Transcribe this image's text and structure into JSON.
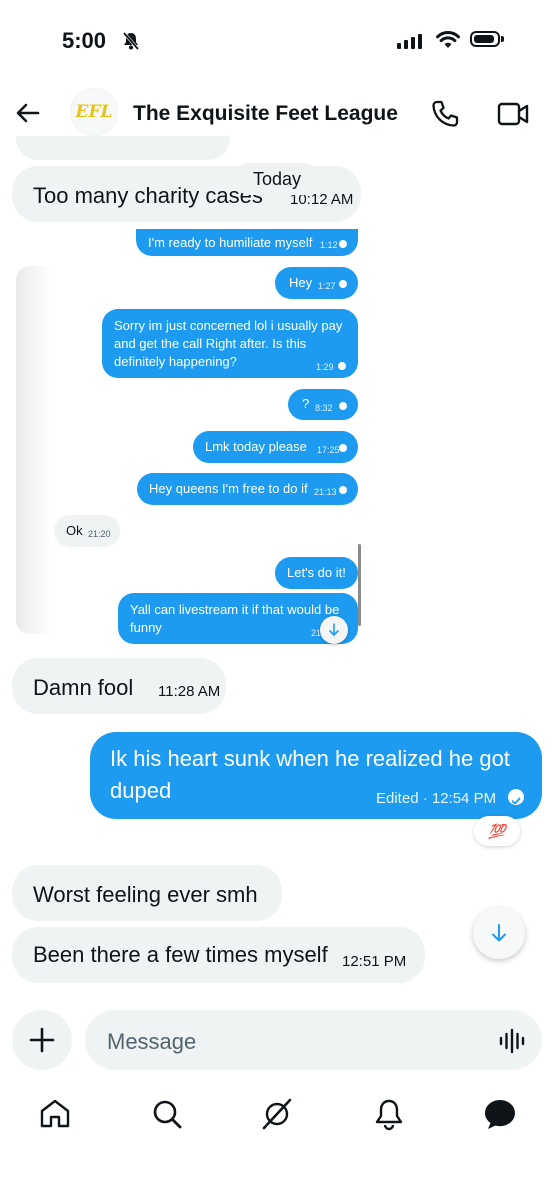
{
  "status_bar": {
    "time": "5:00",
    "silent_icon": "bell-slash-icon",
    "signal_icon": "cellular-signal-icon",
    "wifi_icon": "wifi-icon",
    "battery_icon": "battery-icon"
  },
  "header": {
    "title": "The Exquisite Feet League",
    "avatar_text": "EFL",
    "back_icon": "arrow-left-icon",
    "call_icon": "phone-icon",
    "video_icon": "video-camera-icon"
  },
  "date_divider": "Today",
  "messages": [
    {
      "text": "Too many charity cases",
      "time": "10:12 AM",
      "direction": "in"
    },
    {
      "text": "Damn fool",
      "time": "11:28 AM",
      "direction": "in"
    },
    {
      "text_line1": "Ik his heart sunk when he realized he got",
      "text_line2": "duped",
      "meta": "Edited · 12:54 PM",
      "direction": "out",
      "reaction": "💯"
    },
    {
      "text": "Worst feeling ever smh",
      "direction": "in"
    },
    {
      "text": "Been there a few times myself",
      "time": "12:51 PM",
      "direction": "in"
    }
  ],
  "embedded_chat": [
    {
      "text": "I'm ready to humiliate myself",
      "time": "1:12",
      "direction": "out"
    },
    {
      "text": "Hey",
      "time": "1:27",
      "direction": "out"
    },
    {
      "text_line1": "Sorry im just concerned lol i usually pay",
      "text_line2": "and get the call Right after. Is this",
      "text_line3": "definitely happening?",
      "time": "1:29",
      "direction": "out"
    },
    {
      "text": "?",
      "time": "8:32",
      "direction": "out"
    },
    {
      "text": "Lmk today please",
      "time": "17:25",
      "direction": "out"
    },
    {
      "text": "Hey queens I'm free to do if",
      "time": "21:13",
      "direction": "out"
    },
    {
      "text": "Ok",
      "time": "21:20",
      "direction": "in"
    },
    {
      "text": "Let's do it!",
      "direction": "out"
    },
    {
      "text_line1": "Yall can livestream it if that would be",
      "text_line2": "funny",
      "time": "21",
      "direction": "out"
    }
  ],
  "composer": {
    "placeholder": "Message",
    "add_icon": "plus-icon",
    "voice_icon": "voice-waveform-icon"
  },
  "bottom_nav": [
    {
      "name": "home",
      "icon": "home-icon"
    },
    {
      "name": "search",
      "icon": "search-icon"
    },
    {
      "name": "grok",
      "icon": "grok-icon"
    },
    {
      "name": "notifications",
      "icon": "bell-icon"
    },
    {
      "name": "messages",
      "icon": "messages-icon"
    }
  ],
  "colors": {
    "accent": "#1d9bf0",
    "bubble_in": "#eff3f4",
    "text": "#0f1419",
    "muted": "#536471"
  }
}
